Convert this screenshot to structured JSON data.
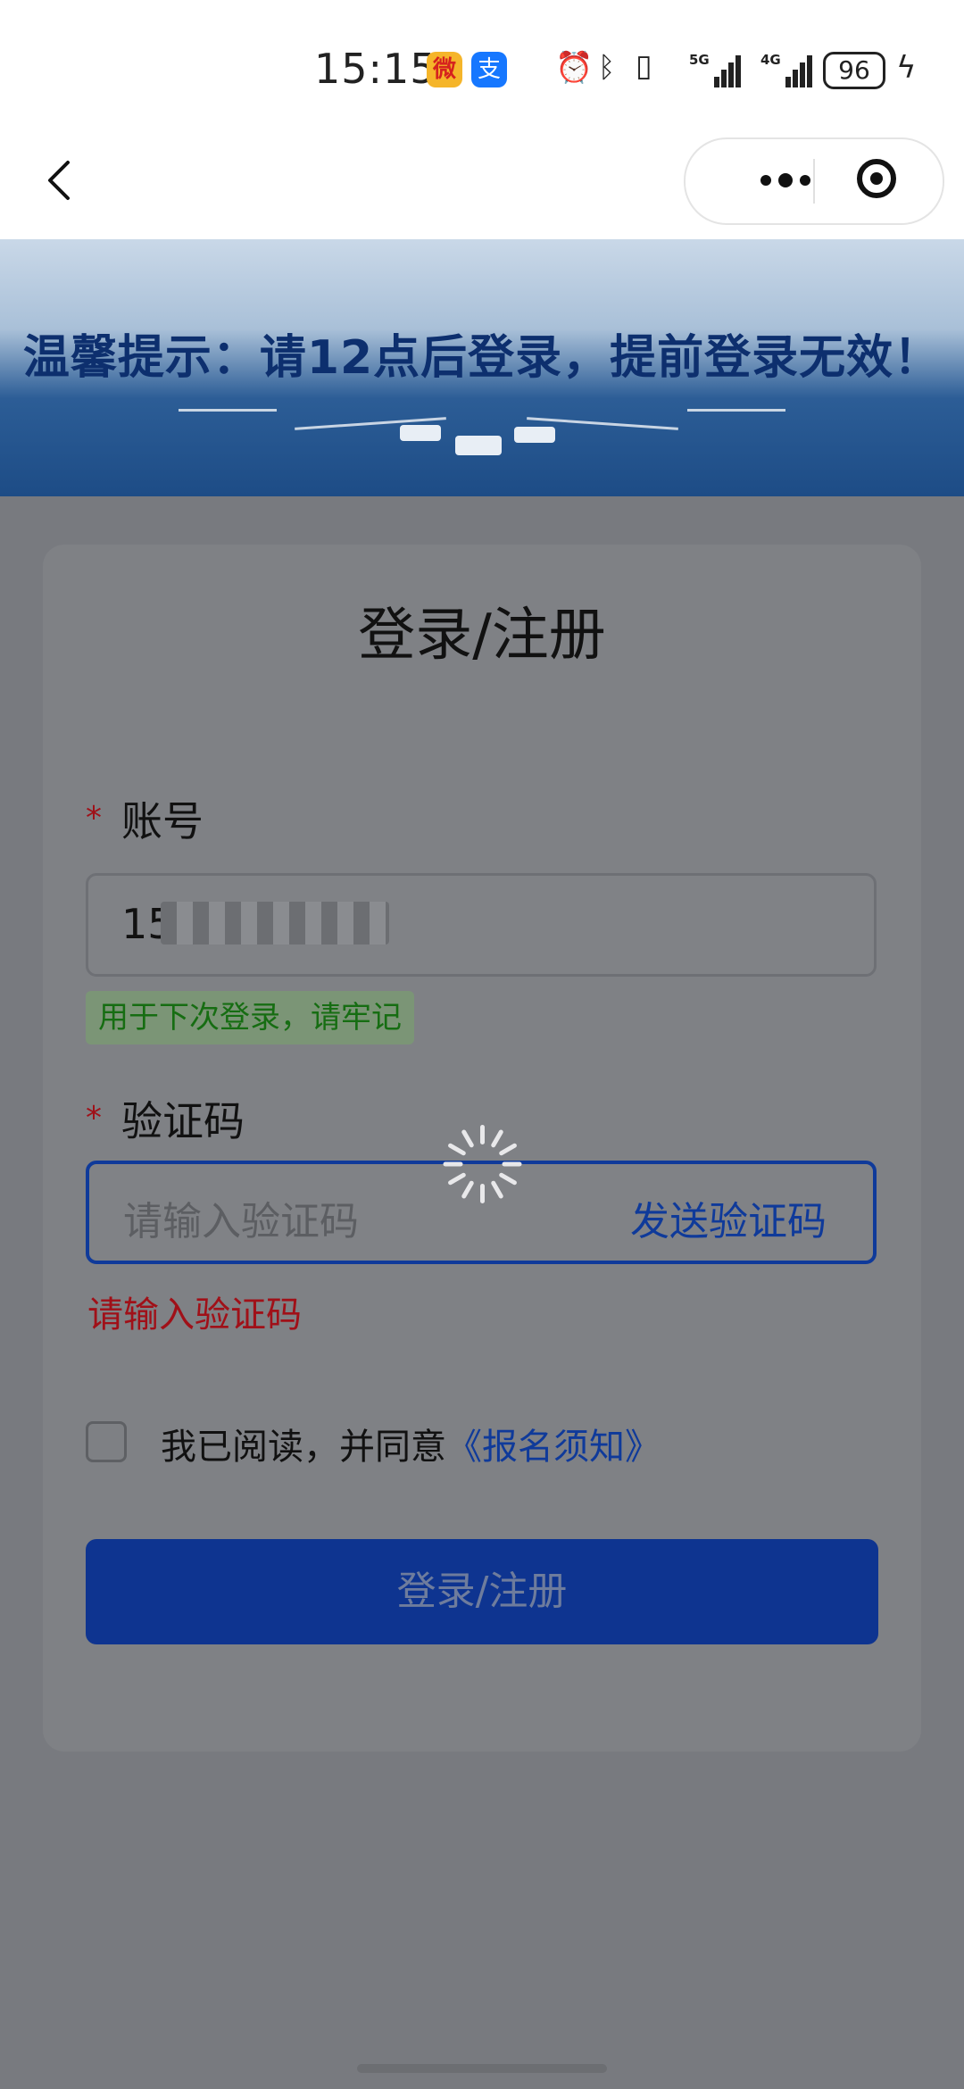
{
  "status_bar": {
    "time": "15:15",
    "weibo_glyph": "微",
    "alipay_glyph": "支",
    "network_1": "5G",
    "network_2": "4G",
    "battery": "96"
  },
  "banner": {
    "text": "温馨提示：请12点后登录，提前登录无效！"
  },
  "form": {
    "title": "登录/注册",
    "required_mark": "*",
    "account_label": "账号",
    "account_value": "15",
    "account_hint": "用于下次登录，请牢记",
    "code_label": "验证码",
    "code_placeholder": "请输入验证码",
    "send_code": "发送验证码",
    "code_error": "请输入验证码",
    "agree_text": "我已阅读，并同意",
    "agree_link": "《报名须知》",
    "submit": "登录/注册"
  },
  "colors": {
    "primary": "#0e3490",
    "error": "#a01018",
    "hint": "#166d12"
  }
}
